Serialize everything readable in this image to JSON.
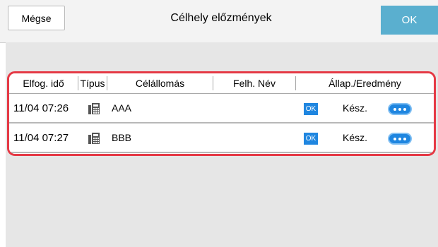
{
  "header": {
    "cancel_label": "Mégse",
    "title": "Célhely előzmények",
    "ok_label": "OK"
  },
  "table": {
    "columns": [
      "Elfog. idő",
      "Típus",
      "Célállomás",
      "Felh. Név",
      "Állap./Eredmény"
    ],
    "rows": [
      {
        "time": "11/04 07:26",
        "type_icon": "fax-icon",
        "destination": "AAA",
        "user": "",
        "status_badge": "OK",
        "status_text": "Kész."
      },
      {
        "time": "11/04 07:27",
        "type_icon": "fax-icon",
        "destination": "BBB",
        "user": "",
        "status_badge": "OK",
        "status_text": "Kész."
      }
    ]
  },
  "colors": {
    "ok_button": "#5aafcf",
    "highlight_frame": "#e53945",
    "status_blue": "#1f86e0"
  }
}
